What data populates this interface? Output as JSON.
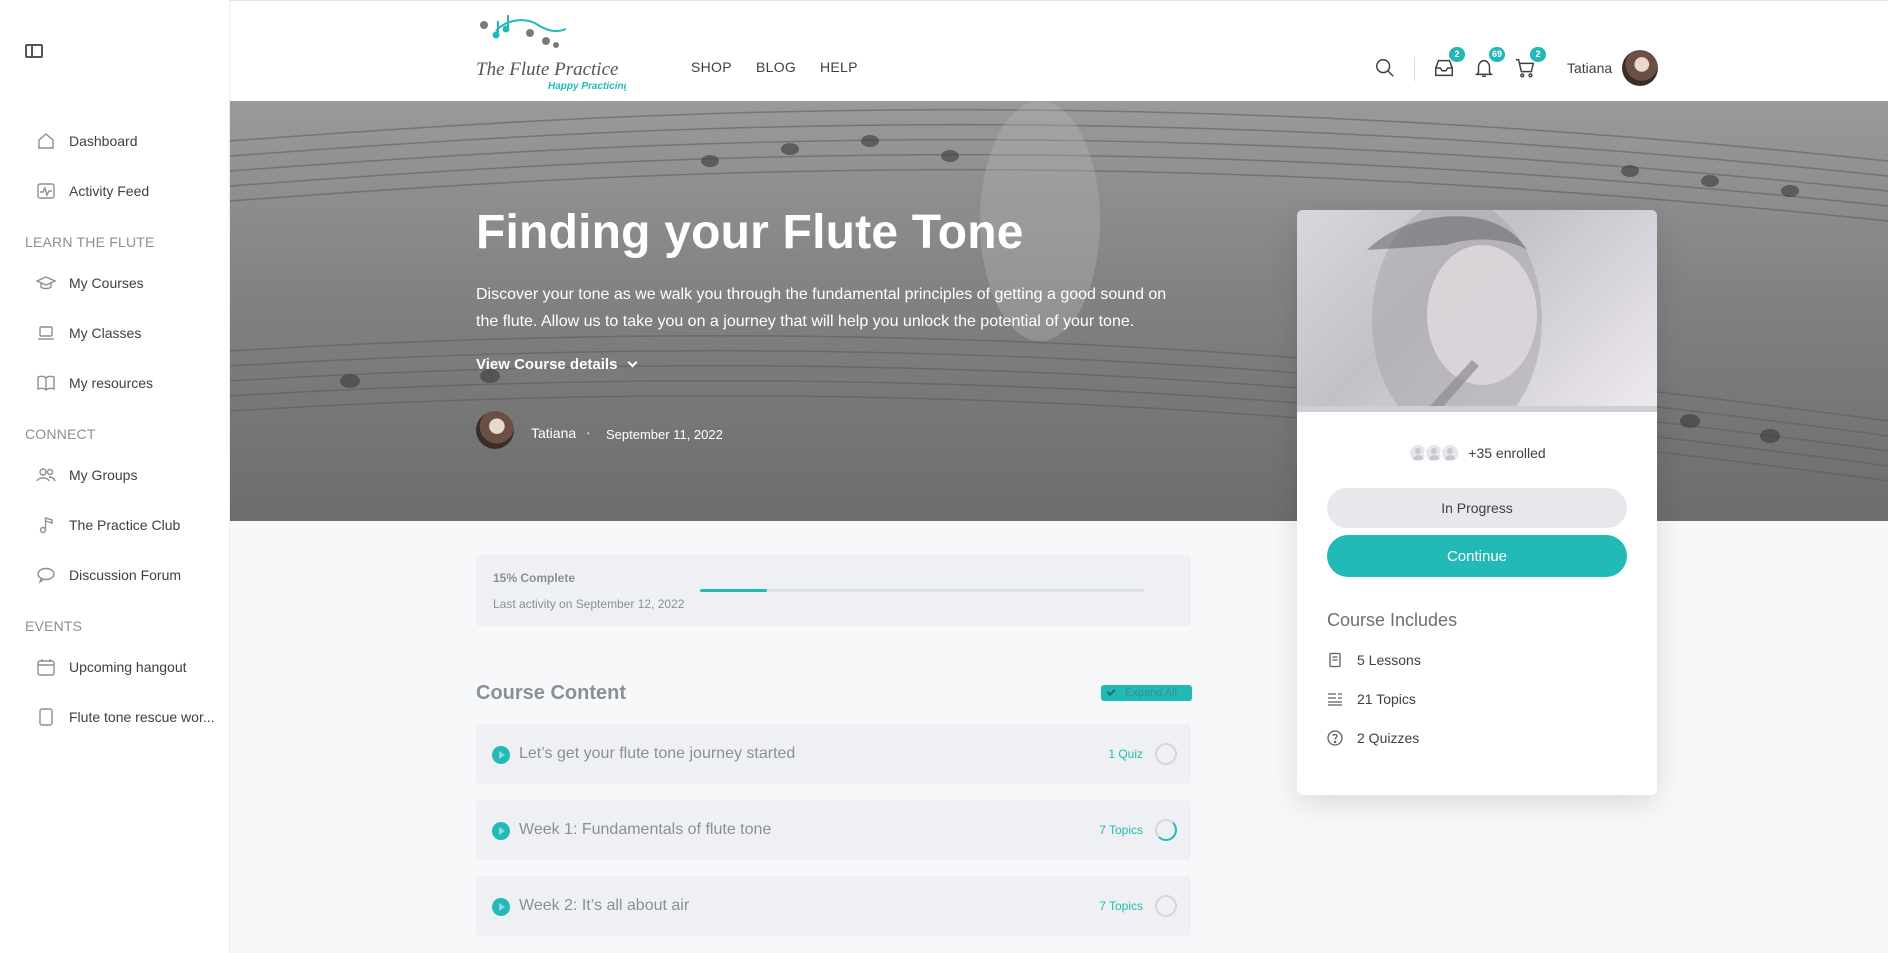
{
  "header": {
    "logo_text": "The Flute Practice",
    "logo_tagline": "Happy Practicing",
    "nav": [
      "SHOP",
      "BLOG",
      "HELP"
    ],
    "badges": {
      "messages": "2",
      "notifications": "69",
      "cart": "2"
    },
    "user_name": "Tatiana"
  },
  "sidebar": {
    "items_top": [
      {
        "label": "Dashboard",
        "icon": "home-icon"
      },
      {
        "label": "Activity Feed",
        "icon": "activity-icon"
      }
    ],
    "sections": [
      {
        "title": "LEARN THE FLUTE",
        "items": [
          {
            "label": "My Courses",
            "icon": "graduation-cap-icon"
          },
          {
            "label": "My Classes",
            "icon": "laptop-icon"
          },
          {
            "label": "My resources",
            "icon": "book-icon"
          }
        ]
      },
      {
        "title": "CONNECT",
        "items": [
          {
            "label": "My Groups",
            "icon": "users-icon"
          },
          {
            "label": "The Practice Club",
            "icon": "music-note-icon"
          },
          {
            "label": "Discussion Forum",
            "icon": "chat-icon"
          }
        ]
      },
      {
        "title": "EVENTS",
        "items": [
          {
            "label": "Upcoming hangout",
            "icon": "calendar-icon"
          },
          {
            "label": "Flute tone rescue wor...",
            "icon": "document-icon"
          }
        ]
      }
    ]
  },
  "hero": {
    "title": "Finding your Flute Tone",
    "description": "Discover your tone as we walk you through the fundamental principles of getting a good sound on the flute. Allow us to take you on a journey that will help you unlock the potential of your tone.",
    "details_link": "View Course details",
    "author": "Tatiana",
    "separator": "·",
    "date": "September 11, 2022"
  },
  "card": {
    "enrolled": "+35 enrolled",
    "status_button": "In Progress",
    "continue_button": "Continue",
    "includes_title": "Course Includes",
    "includes": [
      {
        "label": "5 Lessons",
        "icon": "lessons-icon"
      },
      {
        "label": "21 Topics",
        "icon": "topics-icon"
      },
      {
        "label": "2 Quizzes",
        "icon": "quiz-icon"
      }
    ]
  },
  "progress": {
    "percent_label": "15% Complete",
    "percent": 15,
    "last_activity": "Last activity on September 12, 2022"
  },
  "course_content": {
    "title": "Course Content",
    "expand_all": "Expand All",
    "lessons": [
      {
        "title": "Let’s get your flute tone journey started",
        "meta": "1 Quiz",
        "status": "not-started"
      },
      {
        "title": "Week 1: Fundamentals of flute tone",
        "meta": "7 Topics",
        "status": "in-progress"
      },
      {
        "title": "Week 2: It’s all about air",
        "meta": "7 Topics",
        "status": "not-started"
      }
    ]
  },
  "colors": {
    "accent": "#21bab6",
    "badge": "#22b8b5"
  }
}
